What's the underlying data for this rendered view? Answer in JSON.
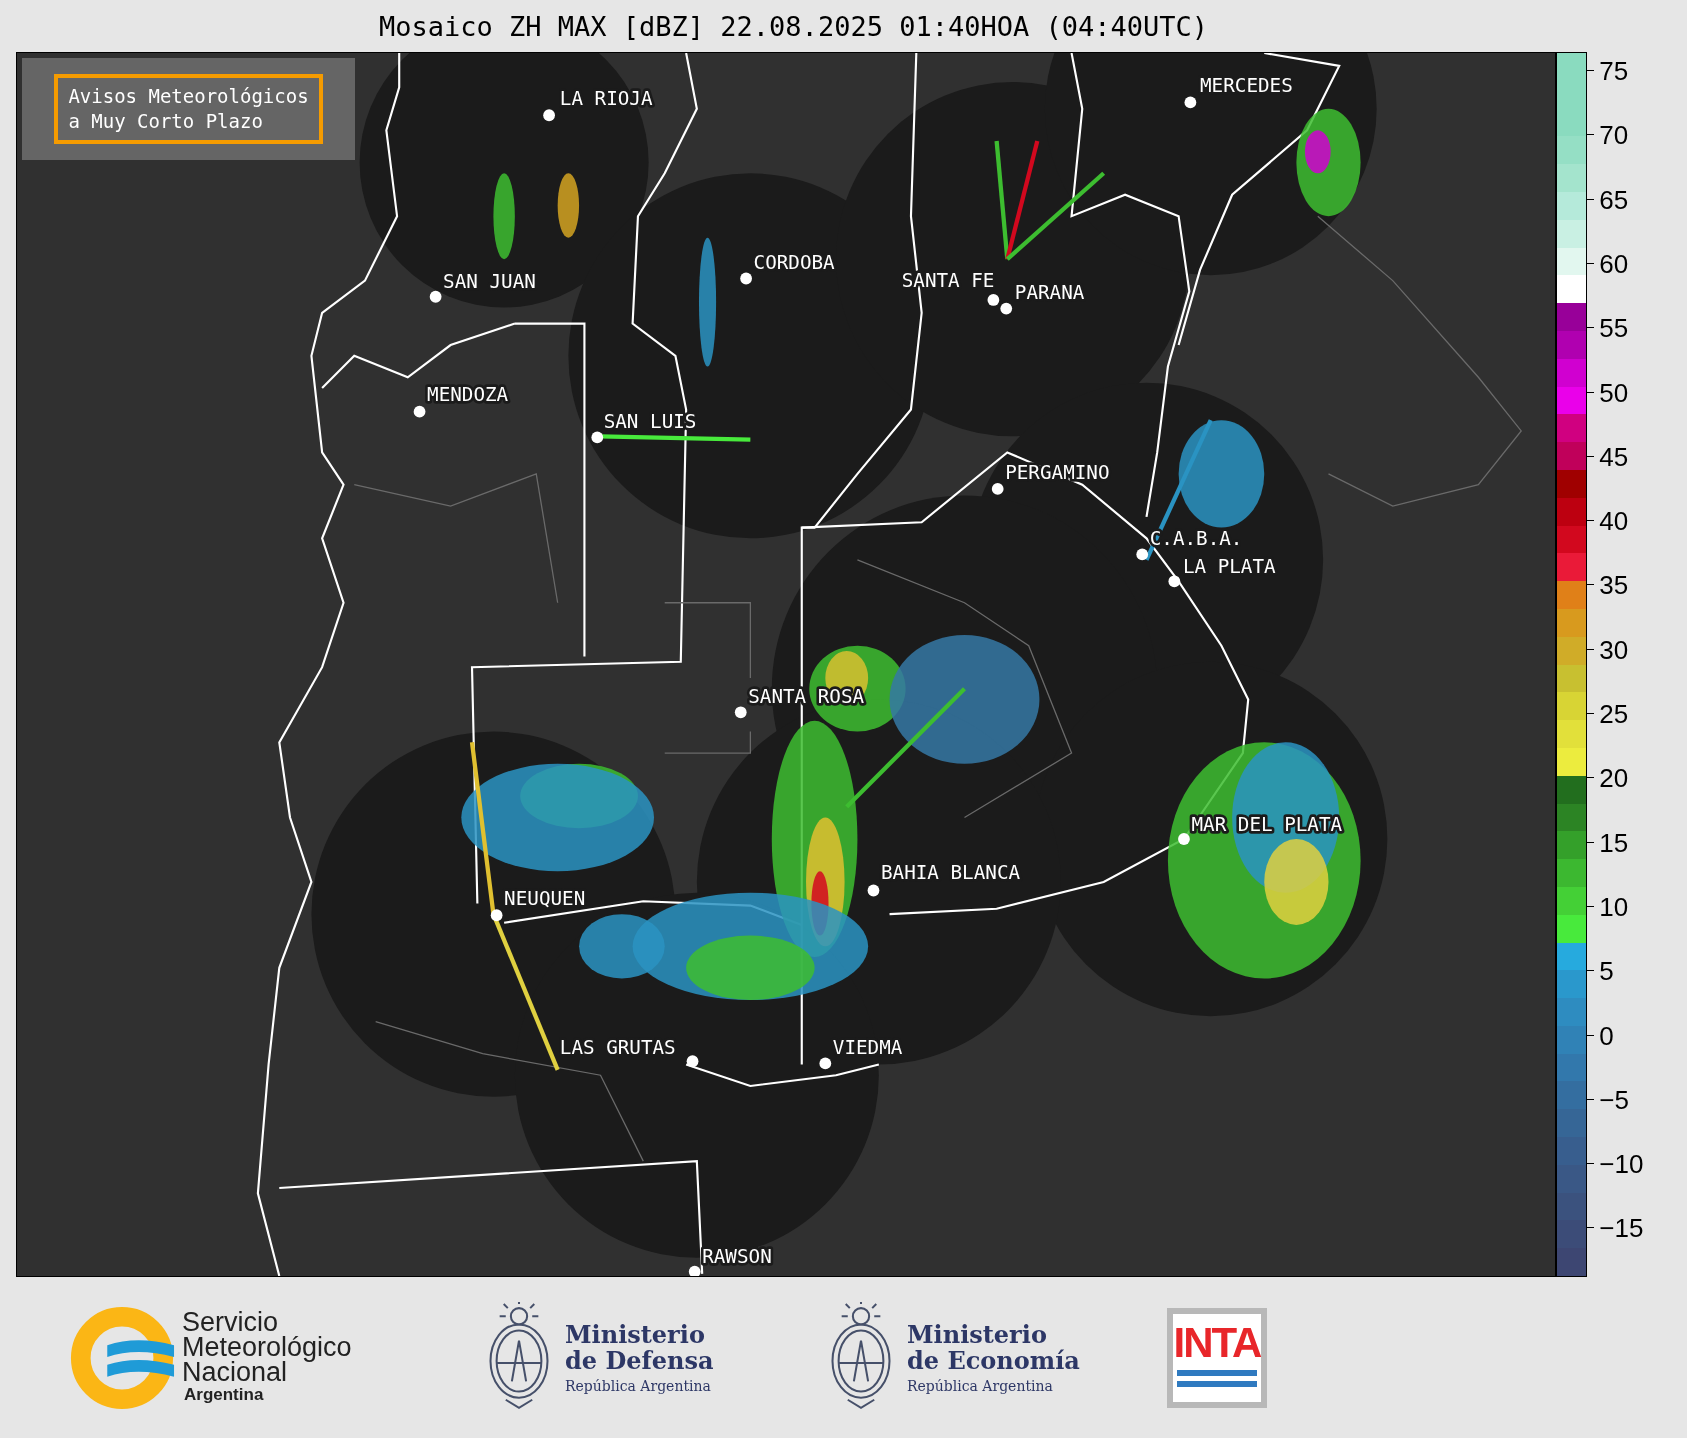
{
  "title": "Mosaico ZH MAX [dBZ] 22.08.2025 01:40HOA (04:40UTC)",
  "notice": {
    "lines": [
      "Avisos Meteorológicos",
      "a Muy Corto Plazo"
    ]
  },
  "cities": [
    {
      "name": "LA RIOJA"
    },
    {
      "name": "MERCEDES"
    },
    {
      "name": "SAN JUAN"
    },
    {
      "name": "CORDOBA"
    },
    {
      "name": "SANTA FE"
    },
    {
      "name": "PARANA"
    },
    {
      "name": "MENDOZA"
    },
    {
      "name": "SAN LUIS"
    },
    {
      "name": "PERGAMINO"
    },
    {
      "name": "C.A.B.A."
    },
    {
      "name": "LA PLATA"
    },
    {
      "name": "SANTA ROSA"
    },
    {
      "name": "MAR DEL PLATA"
    },
    {
      "name": "BAHIA BLANCA"
    },
    {
      "name": "NEUQUEN"
    },
    {
      "name": "LAS GRUTAS"
    },
    {
      "name": "VIEDMA"
    },
    {
      "name": "RAWSON"
    }
  ],
  "colorbar": {
    "ticks": [
      "75",
      "70",
      "65",
      "60",
      "55",
      "50",
      "45",
      "40",
      "35",
      "30",
      "25",
      "20",
      "15",
      "10",
      "5",
      "0",
      "−5",
      "−10",
      "−15"
    ],
    "segments": [
      {
        "color": "#8adbbf"
      },
      {
        "color": "#8adbbf"
      },
      {
        "color": "#8adbbf"
      },
      {
        "color": "#95dfc5"
      },
      {
        "color": "#a4e4cd"
      },
      {
        "color": "#b5eada"
      },
      {
        "color": "#c9f0e3"
      },
      {
        "color": "#e2f7ef"
      },
      {
        "color": "#ffffff"
      },
      {
        "color": "#980099"
      },
      {
        "color": "#b000b0"
      },
      {
        "color": "#d000d0"
      },
      {
        "color": "#ea00ea"
      },
      {
        "color": "#d00080"
      },
      {
        "color": "#c0005a"
      },
      {
        "color": "#a00000"
      },
      {
        "color": "#bd0010"
      },
      {
        "color": "#d2081e"
      },
      {
        "color": "#ea1a38"
      },
      {
        "color": "#e08018"
      },
      {
        "color": "#d89a1e"
      },
      {
        "color": "#d0ac28"
      },
      {
        "color": "#c8c030"
      },
      {
        "color": "#d8d434"
      },
      {
        "color": "#e2e03a"
      },
      {
        "color": "#ecec3e"
      },
      {
        "color": "#226e1e"
      },
      {
        "color": "#2c8424"
      },
      {
        "color": "#34a02a"
      },
      {
        "color": "#3cb830"
      },
      {
        "color": "#44d036"
      },
      {
        "color": "#48ea3c"
      },
      {
        "color": "#26aade"
      },
      {
        "color": "#2a98cc"
      },
      {
        "color": "#2e8cc0"
      },
      {
        "color": "#3082b6"
      },
      {
        "color": "#3278ac"
      },
      {
        "color": "#346ea0"
      },
      {
        "color": "#366696"
      },
      {
        "color": "#385e8e"
      },
      {
        "color": "#3a5886"
      },
      {
        "color": "#3b527e"
      },
      {
        "color": "#3c4c78"
      },
      {
        "color": "#3d4672"
      }
    ]
  },
  "logos": [
    {
      "kind": "smn",
      "lines": [
        "Servicio",
        "Meteorológico",
        "Nacional"
      ],
      "sub": "Argentina"
    },
    {
      "kind": "ministry",
      "lines": [
        "Ministerio",
        "de Defensa"
      ],
      "sub": "República Argentina"
    },
    {
      "kind": "ministry",
      "lines": [
        "Ministerio",
        "de Economía"
      ],
      "sub": "República Argentina"
    },
    {
      "kind": "inta",
      "lines": [
        "INTA"
      ]
    }
  ]
}
